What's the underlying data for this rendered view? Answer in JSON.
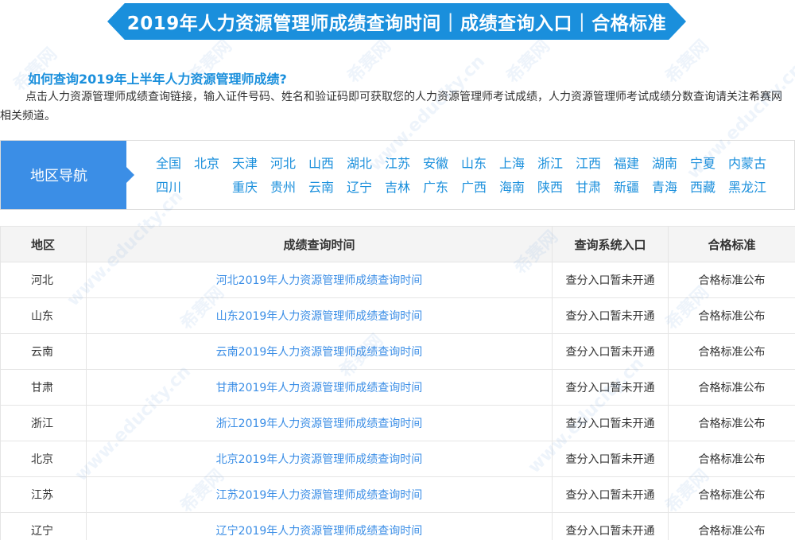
{
  "banner": {
    "part1": "2019年人力资源管理师成绩查询时间",
    "separator": "|",
    "part2": "成绩查询入口",
    "part3": "合格标准"
  },
  "question": "如何查询2019年上半年人力资源管理师成绩?",
  "intro": "点击人力资源管理师成绩查询链接，输入证件号码、姓名和验证码即可获取您的人力资源管理师考试成绩，人力资源管理师考试成绩分数查询请关注希赛网相关频道。",
  "region_nav": {
    "title": "地区导航",
    "row1": [
      "全国",
      "北京",
      "天津",
      "河北",
      "山西",
      "湖北",
      "江苏",
      "安徽",
      "山东",
      "上海",
      "浙江",
      "江西",
      "福建",
      "湖南",
      "宁夏",
      "内蒙古"
    ],
    "row2": [
      "四川",
      "",
      "重庆",
      "贵州",
      "云南",
      "辽宁",
      "吉林",
      "广东",
      "广西",
      "海南",
      "陕西",
      "甘肃",
      "新疆",
      "青海",
      "西藏",
      "黑龙江"
    ]
  },
  "table": {
    "headers": [
      "地区",
      "成绩查询时间",
      "查询系统入口",
      "合格标准"
    ],
    "rows": [
      {
        "region": "河北",
        "link": "河北2019年人力资源管理师成绩查询时间",
        "entry": "查分入口暂未开通",
        "standard": "合格标准公布"
      },
      {
        "region": "山东",
        "link": "山东2019年人力资源管理师成绩查询时间",
        "entry": "查分入口暂未开通",
        "standard": "合格标准公布"
      },
      {
        "region": "云南",
        "link": "云南2019年人力资源管理师成绩查询时间",
        "entry": "查分入口暂未开通",
        "standard": "合格标准公布"
      },
      {
        "region": "甘肃",
        "link": "甘肃2019年人力资源管理师成绩查询时间",
        "entry": "查分入口暂未开通",
        "standard": "合格标准公布"
      },
      {
        "region": "浙江",
        "link": "浙江2019年人力资源管理师成绩查询时间",
        "entry": "查分入口暂未开通",
        "standard": "合格标准公布"
      },
      {
        "region": "北京",
        "link": "北京2019年人力资源管理师成绩查询时间",
        "entry": "查分入口暂未开通",
        "standard": "合格标准公布"
      },
      {
        "region": "江苏",
        "link": "江苏2019年人力资源管理师成绩查询时间",
        "entry": "查分入口暂未开通",
        "standard": "合格标准公布"
      },
      {
        "region": "辽宁",
        "link": "辽宁2019年人力资源管理师成绩查询时间",
        "entry": "查分入口暂未开通",
        "standard": "合格标准公布"
      }
    ]
  },
  "watermark": {
    "text1": "希赛网",
    "text2": "www.educity.cn"
  },
  "colors": {
    "accent": "#1a8fdc",
    "nav_head": "#3b8ee6",
    "link": "#3b8ee6"
  }
}
